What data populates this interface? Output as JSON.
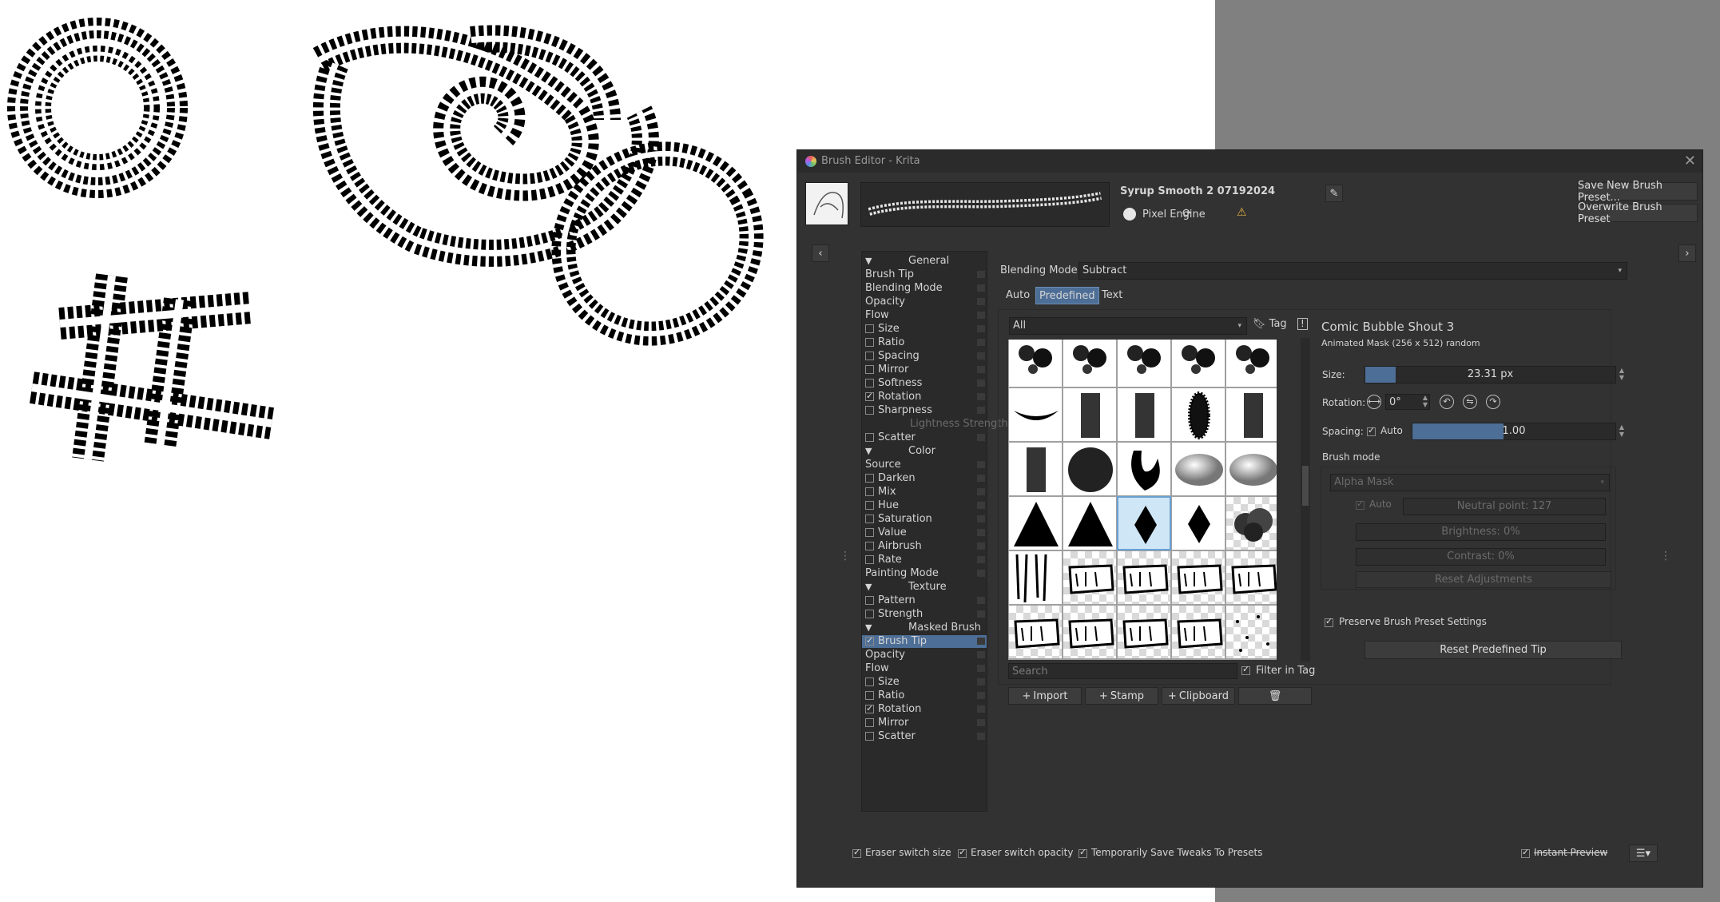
{
  "window": {
    "title": "Brush Editor - Krita",
    "close_icon": "close-icon"
  },
  "preset": {
    "name": "Syrup Smooth 2 07192024",
    "engine_label": "Pixel Engine",
    "save_new_label": "Save New Brush Preset...",
    "overwrite_label": "Overwrite Brush Preset"
  },
  "options": [
    {
      "label": "General",
      "type": "header"
    },
    {
      "label": "Brush Tip",
      "type": "plain"
    },
    {
      "label": "Blending Mode",
      "type": "plain"
    },
    {
      "label": "Opacity",
      "type": "plain"
    },
    {
      "label": "Flow",
      "type": "plain"
    },
    {
      "label": "Size",
      "type": "check",
      "checked": false
    },
    {
      "label": "Ratio",
      "type": "check",
      "checked": false
    },
    {
      "label": "Spacing",
      "type": "check",
      "checked": false
    },
    {
      "label": "Mirror",
      "type": "check",
      "checked": false
    },
    {
      "label": "Softness",
      "type": "check",
      "checked": false
    },
    {
      "label": "Rotation",
      "type": "check",
      "checked": true
    },
    {
      "label": "Sharpness",
      "type": "check",
      "checked": false
    },
    {
      "label": "Lightness Strength",
      "type": "disabled"
    },
    {
      "label": "Scatter",
      "type": "check",
      "checked": false
    },
    {
      "label": "Color",
      "type": "header"
    },
    {
      "label": "Source",
      "type": "plain"
    },
    {
      "label": "Darken",
      "type": "check",
      "checked": false
    },
    {
      "label": "Mix",
      "type": "check",
      "checked": false
    },
    {
      "label": "Hue",
      "type": "check",
      "checked": false
    },
    {
      "label": "Saturation",
      "type": "check",
      "checked": false
    },
    {
      "label": "Value",
      "type": "check",
      "checked": false
    },
    {
      "label": "Airbrush",
      "type": "check",
      "checked": false
    },
    {
      "label": "Rate",
      "type": "check",
      "checked": false
    },
    {
      "label": "Painting Mode",
      "type": "plain"
    },
    {
      "label": "Texture",
      "type": "header"
    },
    {
      "label": "Pattern",
      "type": "check",
      "checked": false
    },
    {
      "label": "Strength",
      "type": "check",
      "checked": false
    },
    {
      "label": "Masked Brush",
      "type": "header"
    },
    {
      "label": "Brush Tip",
      "type": "check",
      "checked": true,
      "selected": true
    },
    {
      "label": "Opacity",
      "type": "plain"
    },
    {
      "label": "Flow",
      "type": "plain"
    },
    {
      "label": "Size",
      "type": "check",
      "checked": false
    },
    {
      "label": "Ratio",
      "type": "check",
      "checked": false
    },
    {
      "label": "Rotation",
      "type": "check",
      "checked": true
    },
    {
      "label": "Mirror",
      "type": "check",
      "checked": false
    },
    {
      "label": "Scatter",
      "type": "check",
      "checked": false
    }
  ],
  "blending": {
    "label": "Blending Mode:",
    "value": "Subtract"
  },
  "tabs": [
    "Auto",
    "Predefined",
    "Text"
  ],
  "active_tab": "Predefined",
  "filter": {
    "value": "All",
    "tag_label": "Tag"
  },
  "brush_tip": {
    "name": "Comic Bubble Shout 3",
    "description": "Animated Mask (256 x 512) random",
    "size_label": "Size:",
    "size_value": "23.31 px",
    "size_fraction": 0.12,
    "rotation_label": "Rotation:",
    "rotation_value": "0°",
    "spacing_label": "Spacing:",
    "spacing_auto_label": "Auto",
    "spacing_value": "1.00",
    "spacing_fraction": 0.45,
    "brush_mode_label": "Brush mode",
    "mode_value": "Alpha Mask",
    "auto_label": "Auto",
    "neutral_point": "Neutral point: 127",
    "brightness": "Brightness: 0%",
    "contrast": "Contrast: 0%",
    "reset_adjustments_label": "Reset Adjustments",
    "preserve_label": "Preserve Brush Preset Settings",
    "reset_tip_label": "Reset Predefined Tip"
  },
  "search": {
    "placeholder": "Search",
    "filter_in_tag_label": "Filter in Tag"
  },
  "actions": {
    "import": "Import",
    "stamp": "Stamp",
    "clipboard": "Clipboard"
  },
  "footer": {
    "eraser_size": "Eraser switch size",
    "eraser_opacity": "Eraser switch opacity",
    "temp_save": "Temporarily Save Tweaks To Presets",
    "instant_preview": "Instant Preview"
  },
  "colors": {
    "panel": "#323232",
    "selection": "#4d6e96",
    "canvas": "#ffffff",
    "gutter": "#808080"
  }
}
